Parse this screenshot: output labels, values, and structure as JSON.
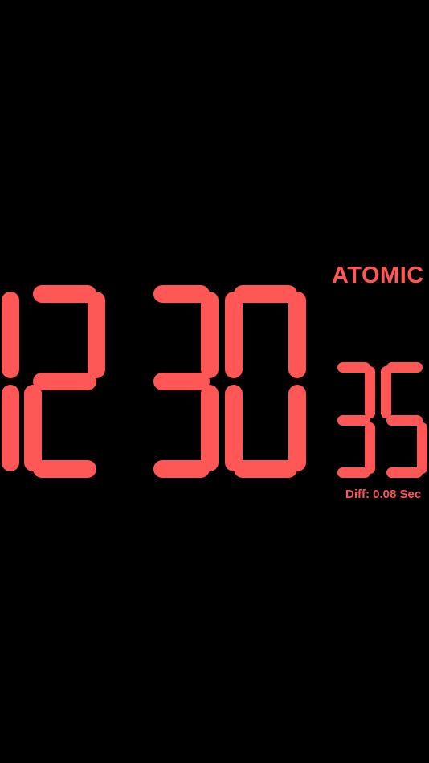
{
  "clock": {
    "hours": "12",
    "minutes": "30",
    "seconds": "35",
    "mode_label": "ATOMIC",
    "diff_label": "Diff: 0.08 Sec"
  },
  "colors": {
    "background": "#000000",
    "digit": "#FF5656",
    "text": "#FF5656"
  }
}
